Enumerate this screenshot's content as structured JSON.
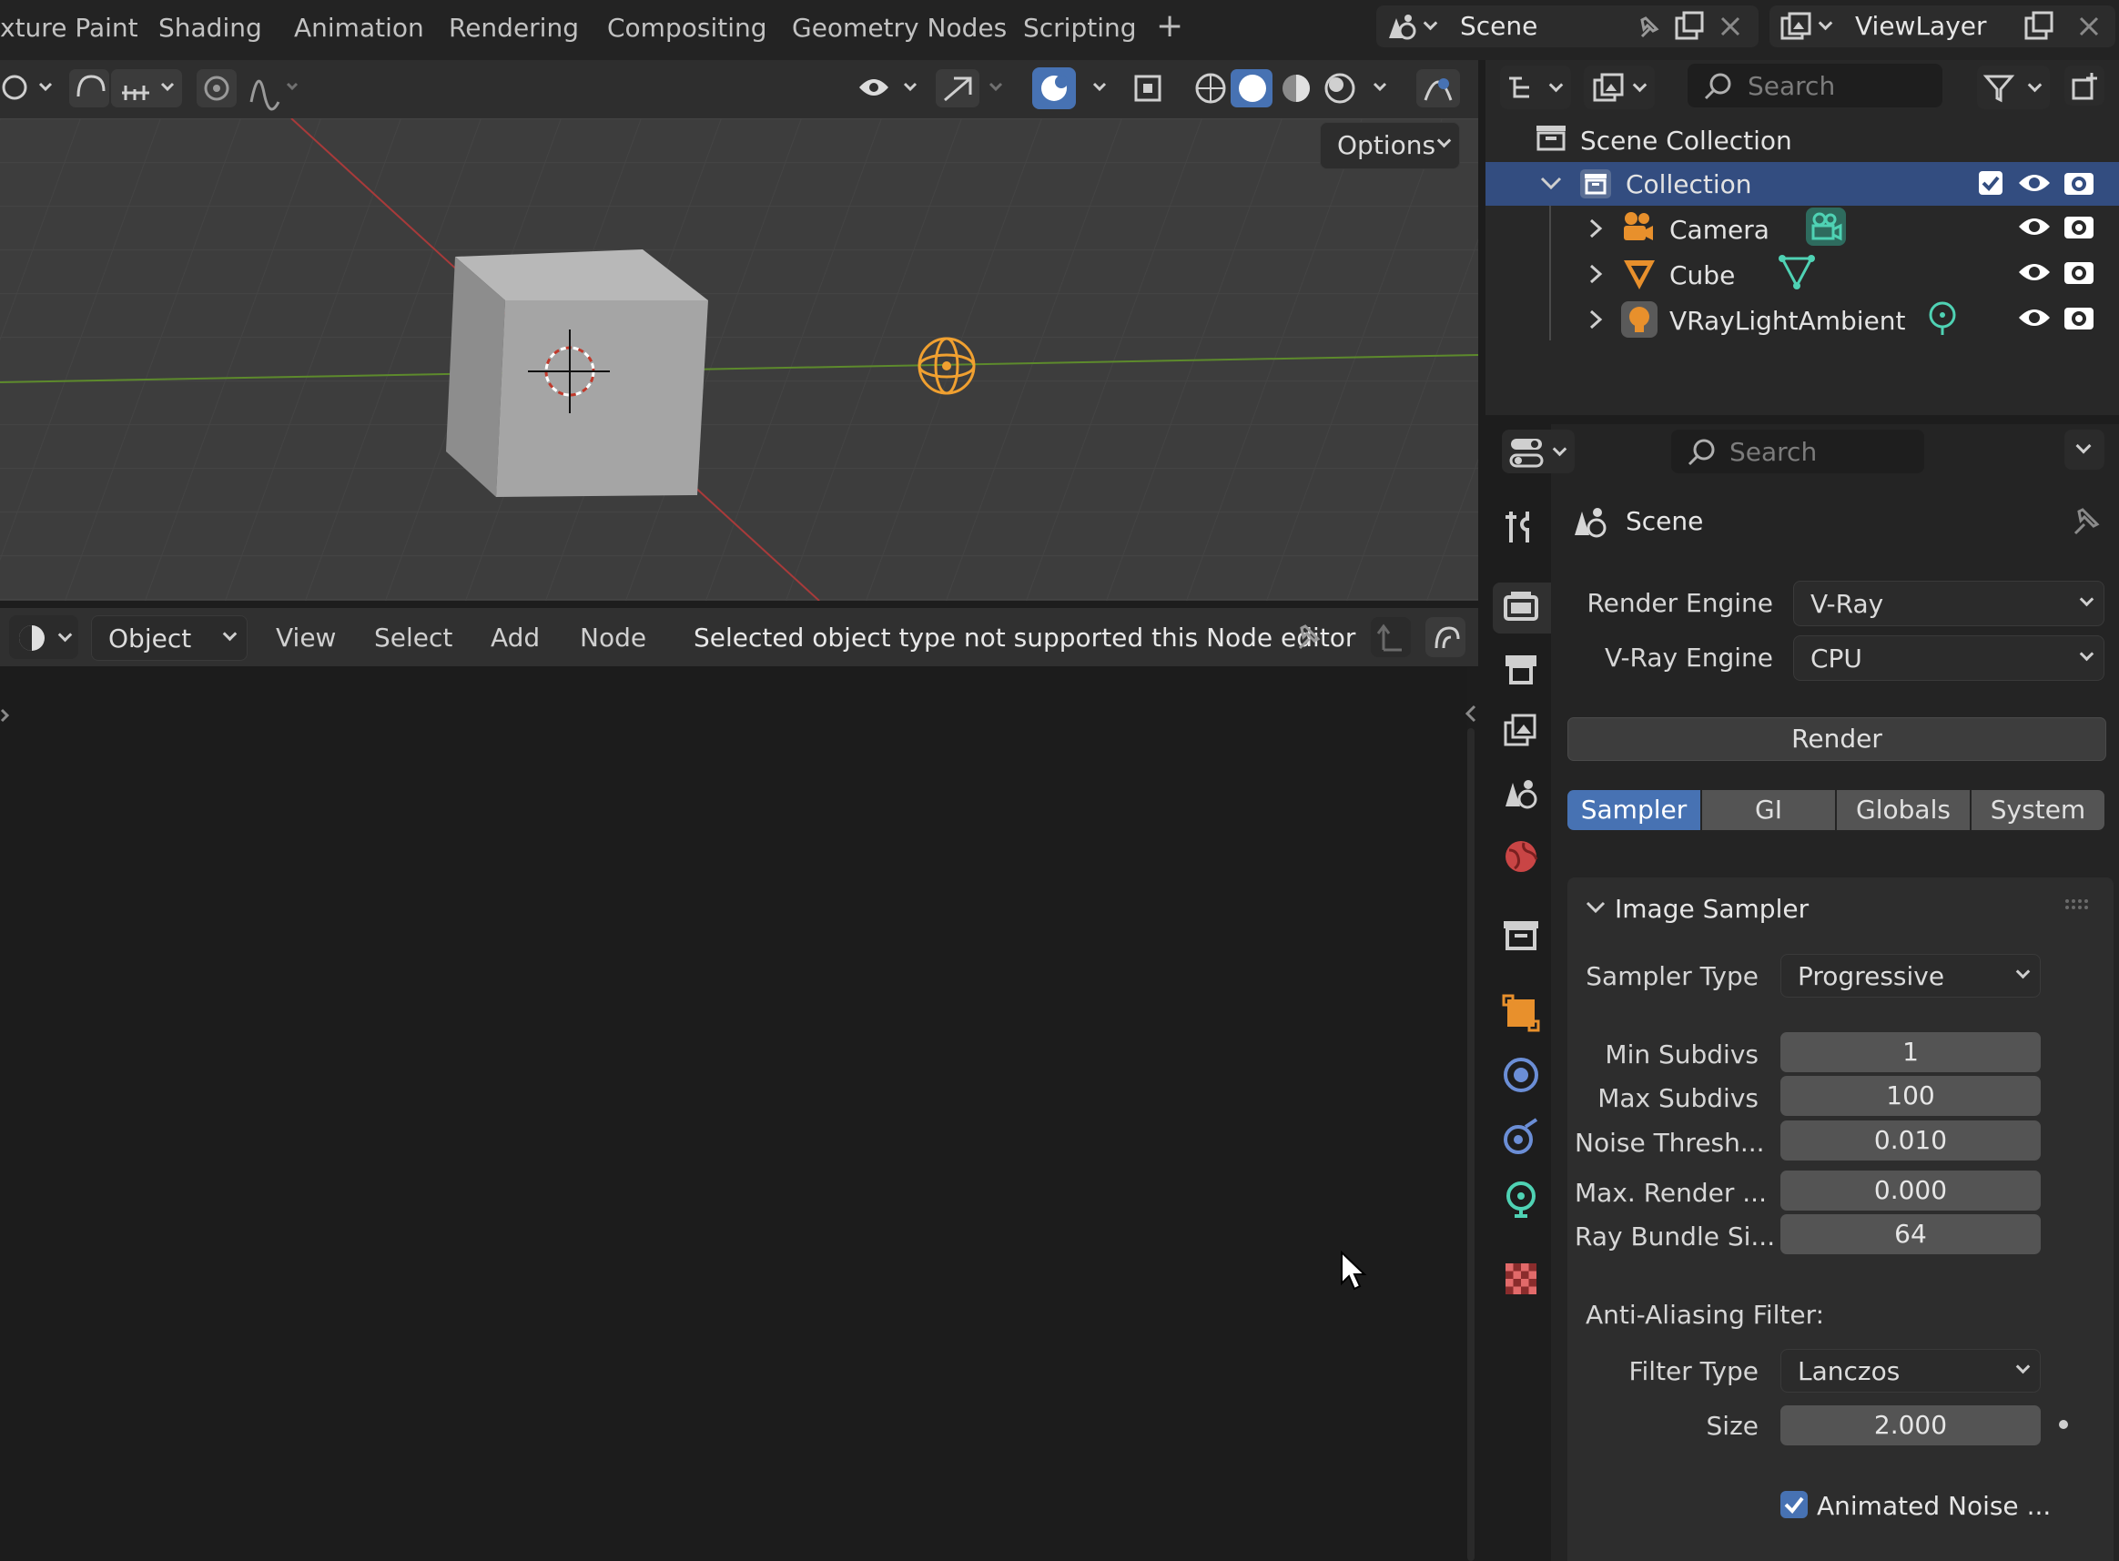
{
  "workspace_tabs": [
    "xture Paint",
    "Shading",
    "Animation",
    "Rendering",
    "Compositing",
    "Geometry Nodes",
    "Scripting"
  ],
  "add_tab_label": "+",
  "scene": {
    "name": "Scene"
  },
  "view_layer": {
    "name": "ViewLayer"
  },
  "viewport": {
    "options_label": "Options"
  },
  "node_editor": {
    "object_mode": "Object",
    "menus": [
      "View",
      "Select",
      "Add",
      "Node"
    ],
    "status_message": "Selected object type not supported this Node editor"
  },
  "outliner": {
    "search_placeholder": "Search",
    "root": "Scene Collection",
    "collection": "Collection",
    "items": [
      "Camera",
      "Cube",
      "VRayLightAmbient"
    ]
  },
  "properties": {
    "search_placeholder": "Search",
    "context_title": "Scene",
    "render_engine_label": "Render Engine",
    "render_engine_value": "V-Ray",
    "vray_engine_label": "V-Ray Engine",
    "vray_engine_value": "CPU",
    "render_button": "Render",
    "tabs": [
      "Sampler",
      "GI",
      "Globals",
      "System"
    ],
    "active_tab": "Sampler",
    "panel_title": "Image Sampler",
    "sampler_type_label": "Sampler Type",
    "sampler_type_value": "Progressive",
    "fields": [
      {
        "label": "Min Subdivs",
        "value": "1"
      },
      {
        "label": "Max Subdivs",
        "value": "100"
      },
      {
        "label": "Noise Thresh...",
        "value": "0.010"
      },
      {
        "label": "Max. Render ...",
        "value": "0.000"
      },
      {
        "label": "Ray Bundle Si...",
        "value": "64"
      }
    ],
    "aa_heading": "Anti-Aliasing Filter:",
    "filter_type_label": "Filter Type",
    "filter_type_value": "Lanczos",
    "size_label": "Size",
    "size_value": "2.000",
    "animated_noise_label": "Animated Noise ...",
    "animated_noise_checked": true
  },
  "colors": {
    "accent": "#4772b3",
    "selected_row": "#334d80",
    "orange": "#e8902c",
    "teal": "#3fbfa0"
  }
}
